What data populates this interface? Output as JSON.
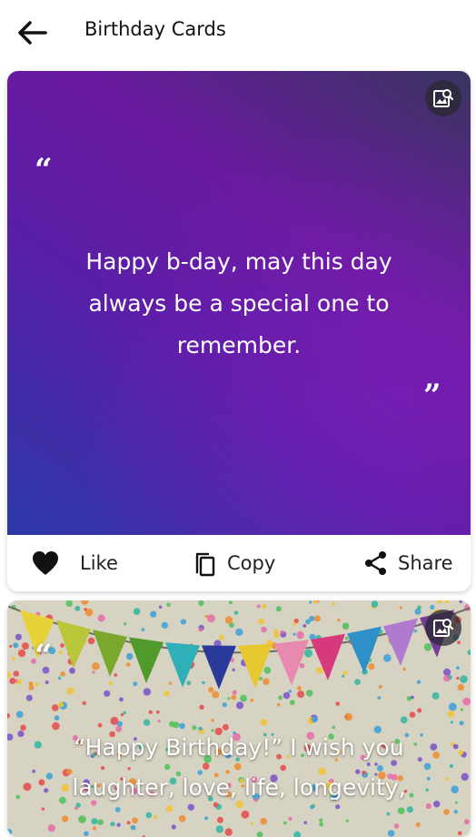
{
  "header": {
    "title": "Birthday Cards"
  },
  "cards": [
    {
      "quote_open": "“",
      "quote_close": "”",
      "text": "Happy b-day, may this day always be a special one to remember.",
      "background": "purple-gradient",
      "like_label": "Like",
      "copy_label": "Copy",
      "share_label": "Share"
    },
    {
      "quote_open": "“",
      "text_line1": "“Happy Birthday!” I wish you",
      "text_line2": "laughter, love, life, longevity,",
      "background": "confetti-bunting-photo"
    }
  ],
  "colors": {
    "gradient_top": "#3a3560",
    "gradient_mid": "#6a1aa0",
    "gradient_bottom": "#2c3aa8",
    "icon_bg": "#2a2a32",
    "text_on_card": "#ffffff"
  },
  "icons": [
    "back-arrow-icon",
    "image-search-icon",
    "heart-icon",
    "copy-icon",
    "share-icon"
  ]
}
